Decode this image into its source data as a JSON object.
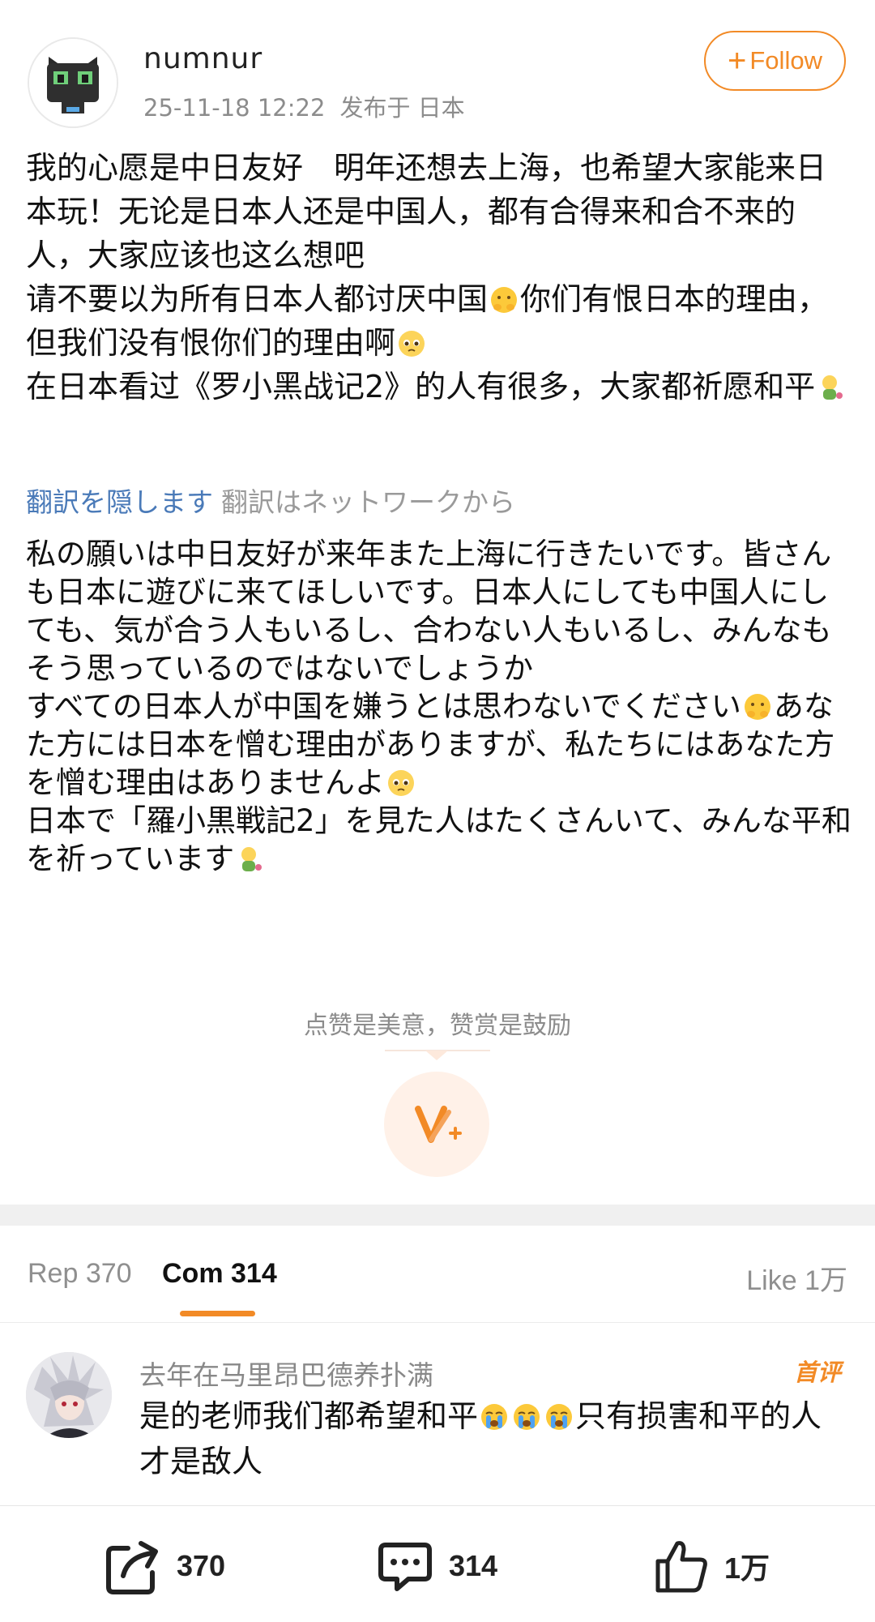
{
  "post": {
    "username": "numnur",
    "datetime": "25-11-18 12:22",
    "location": "发布于 日本",
    "follow_label": "Follow",
    "original_text": {
      "line1": "我的心愿是中日友好　明年还想去上海，也希望大家能来日本玩！无论是日本人还是中国人，都有合得来和合不来的人，大家应该也这么想吧",
      "line2a": "请不要以为所有日本人都讨厌中国",
      "line2b": "你们有恨日本的理由，但我们没有恨你们的理由啊",
      "line3": "在日本看过《罗小黑战记2》的人有很多，大家都祈愿和平"
    },
    "translation_hide_label": "翻訳を隠します",
    "translation_source": "翻訳はネットワークから",
    "translated_text": {
      "line1": "私の願いは中日友好が来年また上海に行きたいです。皆さんも日本に遊びに来てほしいです。日本人にしても中国人にしても、気が合う人もいるし、合わない人もいるし、みんなもそう思っているのではないでしょうか",
      "line2a": "すべての日本人が中国を嫌うとは思わないでください",
      "line2b": "あなた方には日本を憎む理由がありますが、私たちにはあなた方を憎む理由はありませんよ",
      "line3": "日本で「羅小黒戦記2」を見た人はたくさんいて、みんな平和を祈っています"
    },
    "reward_text": "点赞是美意，赞赏是鼓励"
  },
  "tabs": {
    "rep": "Rep 370",
    "com": "Com 314",
    "like": "Like 1万"
  },
  "comment": {
    "username": "去年在马里昂巴德养扑满",
    "badge": "首评",
    "text_a": "是的老师我们都希望和平",
    "text_b": "只有损害和平的人才是敌人"
  },
  "bottom_bar": {
    "repost_count": "370",
    "comment_count": "314",
    "like_count": "1万"
  },
  "colors": {
    "accent": "#f28a26",
    "link": "#4a7ab8",
    "muted": "#8c8c8c"
  },
  "icons": [
    "cat-avatar",
    "plus-icon",
    "worried-face-emoji",
    "pleading-face-emoji",
    "praying-figure-emoji",
    "reward-v-icon",
    "crying-face-emoji",
    "share-icon",
    "comment-icon",
    "thumbs-up-icon"
  ]
}
